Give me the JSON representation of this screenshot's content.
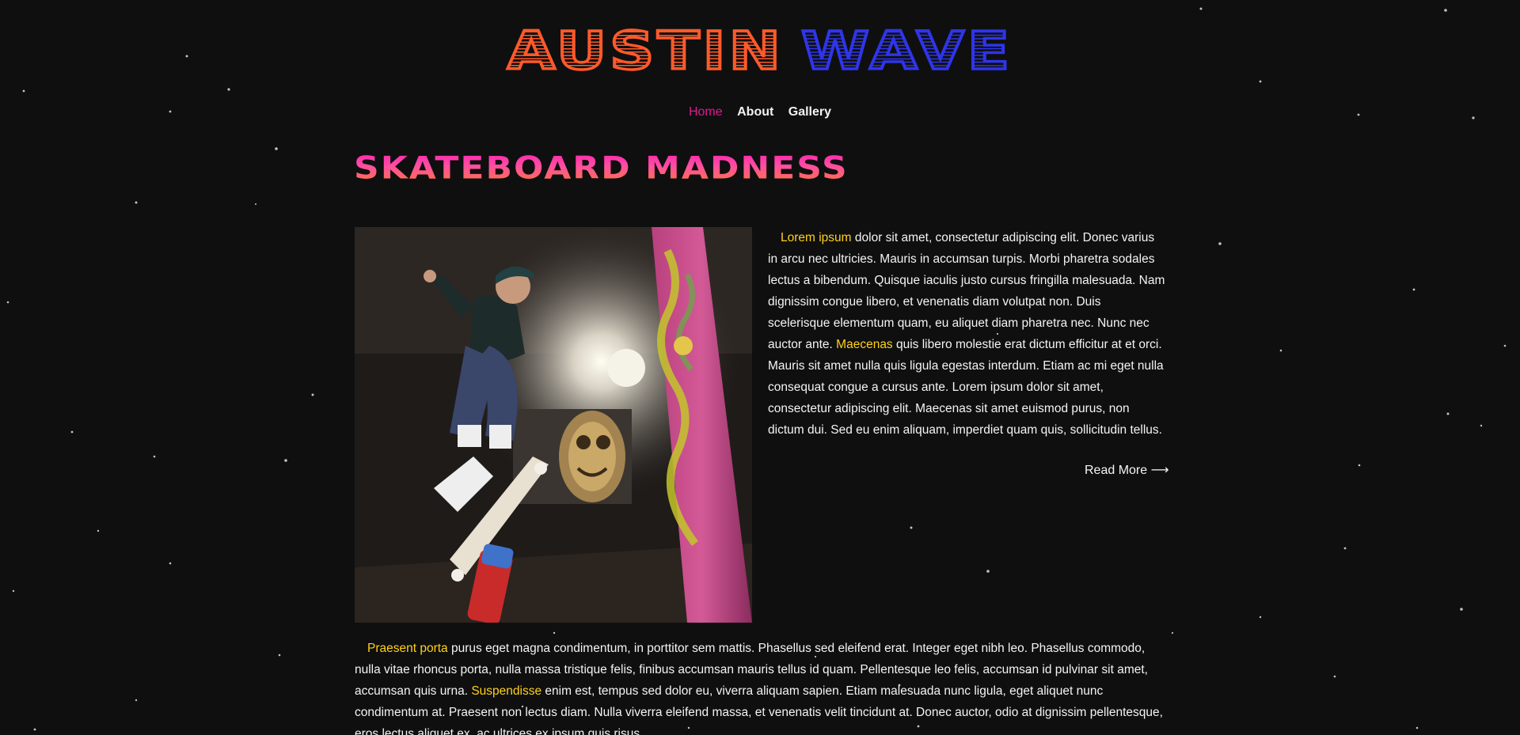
{
  "site": {
    "logo_word1": "AUSTIN",
    "logo_word2": "WAVE"
  },
  "nav": {
    "items": [
      {
        "label": "Home"
      },
      {
        "label": "About"
      },
      {
        "label": "Gallery"
      }
    ],
    "active": "Home"
  },
  "article": {
    "title": "SKATEBOARD MADNESS",
    "intro": {
      "hl1": "Lorem ipsum",
      "text1": " dolor sit amet, consectetur adipiscing elit. Donec varius in arcu nec ultricies. Mauris in accumsan turpis. Morbi pharetra sodales lectus a bibendum. Quisque iaculis justo cursus fringilla malesuada. Nam dignissim congue libero, et venenatis diam volutpat non. Duis scelerisque elementum quam, eu aliquet diam pharetra nec. Nunc nec auctor ante. ",
      "hl2": "Maecenas",
      "text2": " quis libero molestie erat dictum efficitur at et orci. Mauris sit amet nulla quis ligula egestas interdum. Etiam ac mi eget nulla consequat congue a cursus ante. Lorem ipsum dolor sit amet, consectetur adipiscing elit. Maecenas sit amet euismod purus, non dictum dui. Sed eu enim aliquam, imperdiet quam quis, sollicitudin tellus."
    },
    "read_more": "Read More ⟶",
    "body": {
      "hl1": "Praesent porta",
      "text1": " purus eget magna condimentum, in porttitor sem mattis. Phasellus sed eleifend erat. Integer eget nibh leo. Phasellus commodo, nulla vitae rhoncus porta, nulla massa tristique felis, finibus accumsan mauris tellus id quam. Pellentesque leo felis, accumsan id pulvinar sit amet, accumsan quis urna. ",
      "hl2": "Suspendisse",
      "text2": " enim est, tempus sed dolor eu, viverra aliquam sapien. Etiam malesuada nunc ligula, eget aliquet nunc condimentum at. Praesent non lectus diam. Nulla viverra eleifend massa, et venenatis velit tincidunt at. Donec auctor, odio at dignissim pellentesque, eros lectus aliquet ex, ac ultrices ex ipsum quis risus."
    }
  },
  "colors": {
    "background": "#0f0f10",
    "logo_orange": "#ff5a2a",
    "logo_blue": "#2f35e8",
    "nav_active": "#e0198f",
    "highlight": "#ffd11a"
  }
}
